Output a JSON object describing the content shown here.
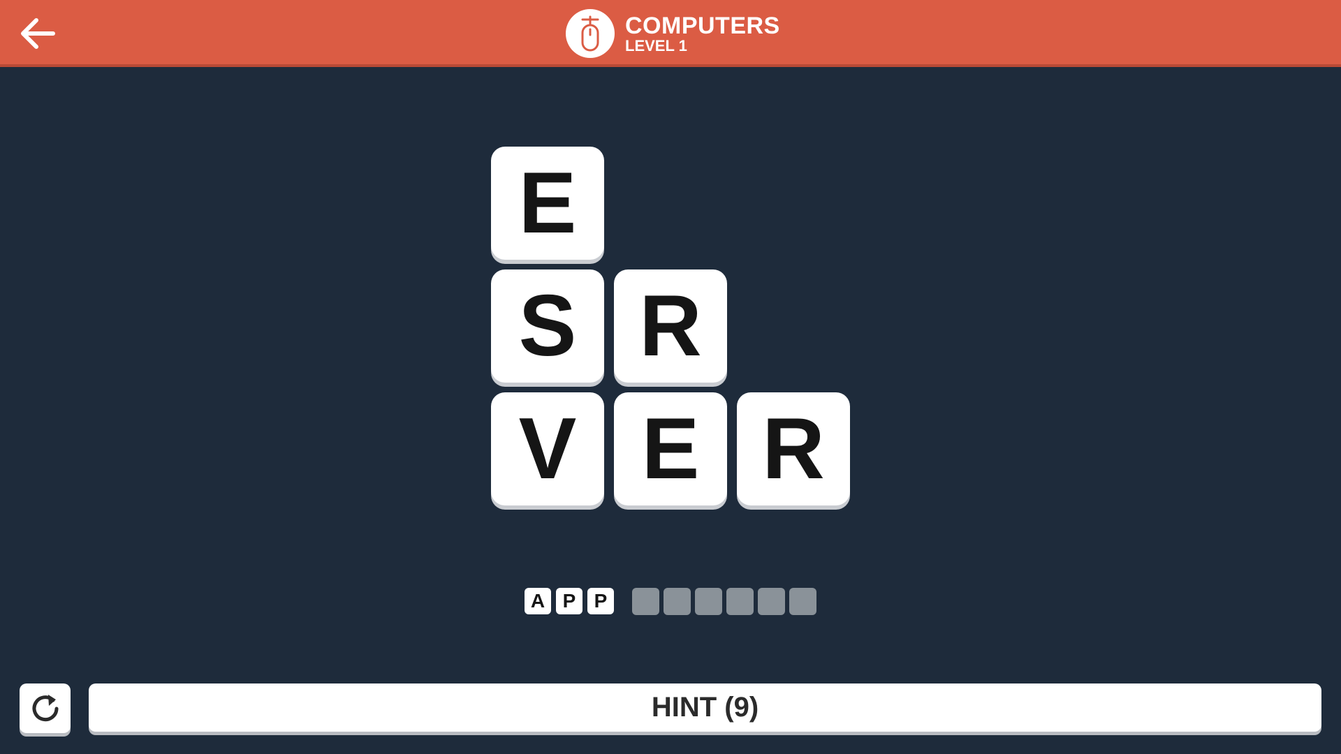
{
  "header": {
    "category": "COMPUTERS",
    "level": "LEVEL 1",
    "category_icon": "computer-mouse-icon",
    "back_icon": "arrow-left-icon"
  },
  "board": {
    "tiles": [
      {
        "letter": "E",
        "row": 0,
        "col": 0
      },
      {
        "letter": "S",
        "row": 1,
        "col": 0
      },
      {
        "letter": "R",
        "row": 1,
        "col": 1
      },
      {
        "letter": "V",
        "row": 2,
        "col": 0
      },
      {
        "letter": "E",
        "row": 2,
        "col": 1
      },
      {
        "letter": "R",
        "row": 2,
        "col": 2
      }
    ]
  },
  "answer": {
    "found_word": [
      "A",
      "P",
      "P"
    ],
    "remaining_slots": 6
  },
  "controls": {
    "restart_icon": "restart-icon",
    "hint_label": "HINT (9)"
  },
  "colors": {
    "header_bg": "#db5c44",
    "board_bg": "#1e2b3b",
    "tile_bg": "#ffffff",
    "slot_empty": "#8a9299"
  }
}
